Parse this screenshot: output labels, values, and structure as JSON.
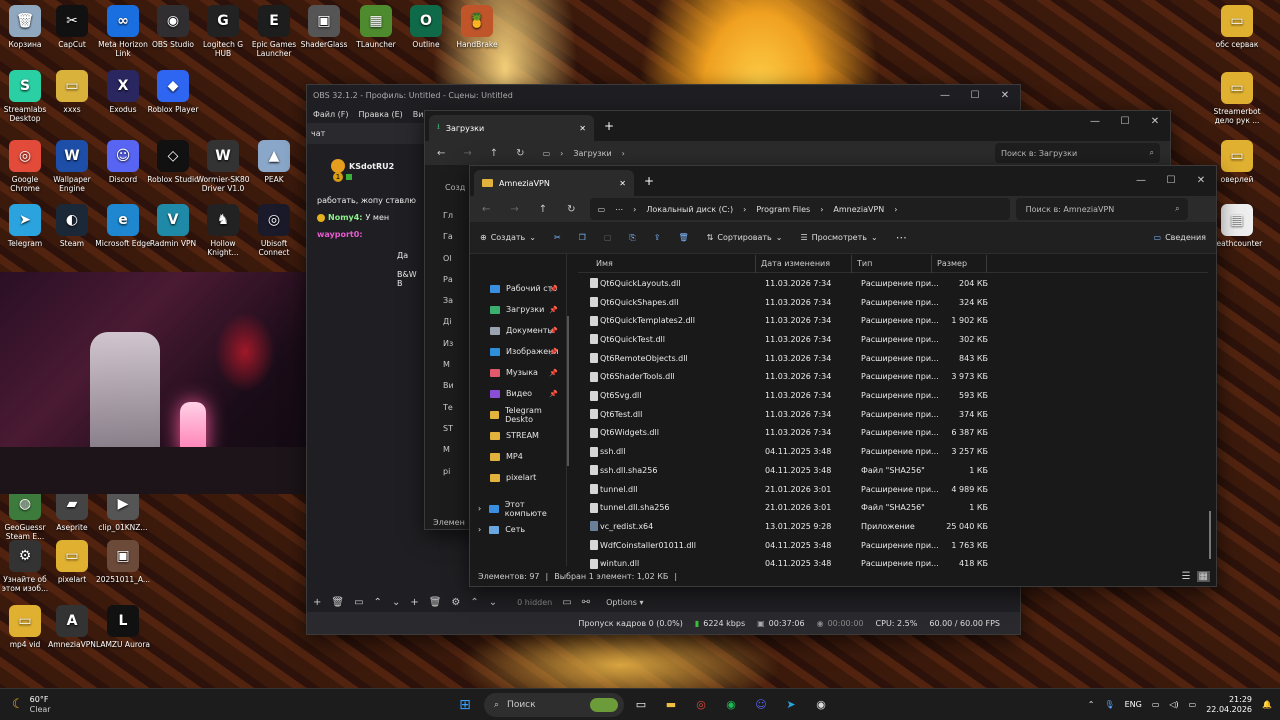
{
  "desktop_icons": [
    {
      "label": "Корзина",
      "color": "#8fa8c0",
      "glyph": "🗑"
    },
    {
      "label": "CapCut",
      "color": "#111",
      "glyph": "✂"
    },
    {
      "label": "Meta Horizon Link",
      "color": "#1a6fe0",
      "glyph": "∞"
    },
    {
      "label": "OBS Studio",
      "color": "#302e31",
      "glyph": "◉"
    },
    {
      "label": "Logitech G HUB",
      "color": "#222",
      "glyph": "G"
    },
    {
      "label": "Epic Games Launcher",
      "color": "#1d1d1d",
      "glyph": "E"
    },
    {
      "label": "ShaderGlass",
      "color": "#555",
      "glyph": "▣"
    },
    {
      "label": "TLauncher",
      "color": "#4e8a2e",
      "glyph": "▦"
    },
    {
      "label": "Outline",
      "color": "#0f6a4a",
      "glyph": "O"
    },
    {
      "label": "HandBrake",
      "color": "#c0552a",
      "glyph": "🍍"
    },
    {
      "label": "Streamlabs Desktop",
      "color": "#2ad0a4",
      "glyph": "S"
    },
    {
      "label": "xxxs",
      "color": "#d9b23b",
      "glyph": "▭"
    },
    {
      "label": "Exodus",
      "color": "#2a2660",
      "glyph": "X"
    },
    {
      "label": "Roblox Player",
      "color": "#2e66f2",
      "glyph": "◆"
    },
    {
      "label": "Google Chrome",
      "color": "#e24a3a",
      "glyph": "◎"
    },
    {
      "label": "Wallpaper Engine",
      "color": "#1d4fa8",
      "glyph": "W"
    },
    {
      "label": "Discord",
      "color": "#5865f2",
      "glyph": "☺"
    },
    {
      "label": "Roblox Studio",
      "color": "#111",
      "glyph": "◇"
    },
    {
      "label": "Wormier-SK80 Driver V1.0",
      "color": "#333",
      "glyph": "W"
    },
    {
      "label": "PEAK",
      "color": "#8aa6c8",
      "glyph": "▲"
    },
    {
      "label": "Telegram",
      "color": "#2aa3df",
      "glyph": "➤"
    },
    {
      "label": "Steam",
      "color": "#1b2838",
      "glyph": "◐"
    },
    {
      "label": "Microsoft Edge",
      "color": "#1f87d0",
      "glyph": "e"
    },
    {
      "label": "Radmin VPN",
      "color": "#1f8aa8",
      "glyph": "V"
    },
    {
      "label": "Hollow Knight...",
      "color": "#222",
      "glyph": "♞"
    },
    {
      "label": "Ubisoft Connect",
      "color": "#1a1a2a",
      "glyph": "◎"
    },
    {
      "label": "GeoGuessr Steam E...",
      "color": "#3d7b3d",
      "glyph": "◍"
    },
    {
      "label": "Aseprite",
      "color": "#444",
      "glyph": "▰"
    },
    {
      "label": "clip_01KNZ...",
      "color": "#555",
      "glyph": "▶"
    },
    {
      "label": "Узнайте об этом изоб...",
      "color": "#333",
      "glyph": "⚙"
    },
    {
      "label": "pixelart",
      "color": "#e0b030",
      "glyph": "▭"
    },
    {
      "label": "20251011_A...",
      "color": "#6b4a3a",
      "glyph": "▣"
    },
    {
      "label": "mp4 vid",
      "color": "#e0b030",
      "glyph": "▭"
    },
    {
      "label": "AmneziaVPN",
      "color": "#333",
      "glyph": "A"
    },
    {
      "label": "LAMZU Aurora",
      "color": "#111",
      "glyph": "L"
    },
    {
      "label": "обс сервак",
      "color": "#e0b030",
      "glyph": "▭"
    },
    {
      "label": "Streamerbot дело рук ...",
      "color": "#e0b030",
      "glyph": "▭"
    },
    {
      "label": "оверлей",
      "color": "#e0b030",
      "glyph": "▭"
    },
    {
      "label": "deathcounter",
      "color": "#eee",
      "glyph": "▤"
    }
  ],
  "obs": {
    "title": "OBS 32.1.2 - Профиль: Untitled - Сцены: Untitled",
    "menu": [
      "Файл (F)",
      "Правка (E)",
      "Вид"
    ],
    "chat_header": "чат",
    "chat": {
      "user1": "KSdotRU2",
      "badge_count": "1",
      "msg1": "работать, жопу ставлю",
      "user2": "Nomy4:",
      "msg2": "У мен",
      "user3": "wayport0:",
      "msg3": "Да",
      "msg4": "B&W B"
    },
    "bottom_hidden": "0 hidden",
    "options": "Options",
    "status": {
      "dropped": "Пропуск кадров 0 (0.0%)",
      "bitrate": "6224 kbps",
      "rec_time": "00:37:06",
      "stream_time": "00:00:00",
      "cpu": "CPU: 2.5%",
      "fps": "60.00 / 60.00 FPS"
    }
  },
  "downloads": {
    "tab": "Загрузки",
    "path": "Загрузки",
    "search": "Поиск в: Загрузки",
    "sidebar_partial": [
      "Гл",
      "Га",
      "Ol",
      "Ра",
      "За",
      "Ді",
      "Из",
      "М",
      "Ви",
      "Те",
      "ST",
      "М",
      "pi"
    ],
    "left_partial_menu": "Созд",
    "element_label": "Элемен"
  },
  "explorer": {
    "tab": "AmneziaVPN",
    "breadcrumb": [
      "Локальный диск (C:)",
      "Program Files",
      "AmneziaVPN"
    ],
    "search_placeholder": "Поиск в: AmneziaVPN",
    "toolbar": {
      "create": "Создать",
      "sort": "Сортировать",
      "view": "Просмотреть",
      "details": "Сведения"
    },
    "columns": {
      "name": "Имя",
      "date": "Дата изменения",
      "type": "Тип",
      "size": "Размер"
    },
    "nav": [
      {
        "label": "Рабочий сто",
        "pin": true,
        "color": "#3a8ee0"
      },
      {
        "label": "Загрузки",
        "pin": true,
        "color": "#3ab06e"
      },
      {
        "label": "Документы",
        "pin": true,
        "color": "#9aa4b0"
      },
      {
        "label": "Изображени",
        "pin": true,
        "color": "#2f8fd8"
      },
      {
        "label": "Музыка",
        "pin": true,
        "color": "#e2596c"
      },
      {
        "label": "Видео",
        "pin": true,
        "color": "#8a4ed8"
      },
      {
        "label": "Telegram Deskto",
        "pin": false,
        "color": "#e2b33c"
      },
      {
        "label": "STREAM",
        "pin": false,
        "color": "#e2b33c"
      },
      {
        "label": "MP4",
        "pin": false,
        "color": "#e2b33c"
      },
      {
        "label": "pixelart",
        "pin": false,
        "color": "#e2b33c"
      }
    ],
    "nav_bottom": [
      "Этот компьюте",
      "Сеть"
    ],
    "files": [
      {
        "name": "Qt6QuickLayouts.dll",
        "date": "11.03.2026 7:34",
        "type": "Расширение при...",
        "size": "204 КБ"
      },
      {
        "name": "Qt6QuickShapes.dll",
        "date": "11.03.2026 7:34",
        "type": "Расширение при...",
        "size": "324 КБ"
      },
      {
        "name": "Qt6QuickTemplates2.dll",
        "date": "11.03.2026 7:34",
        "type": "Расширение при...",
        "size": "1 902 КБ"
      },
      {
        "name": "Qt6QuickTest.dll",
        "date": "11.03.2026 7:34",
        "type": "Расширение при...",
        "size": "302 КБ"
      },
      {
        "name": "Qt6RemoteObjects.dll",
        "date": "11.03.2026 7:34",
        "type": "Расширение при...",
        "size": "843 КБ"
      },
      {
        "name": "Qt6ShaderTools.dll",
        "date": "11.03.2026 7:34",
        "type": "Расширение при...",
        "size": "3 973 КБ"
      },
      {
        "name": "Qt6Svg.dll",
        "date": "11.03.2026 7:34",
        "type": "Расширение при...",
        "size": "593 КБ"
      },
      {
        "name": "Qt6Test.dll",
        "date": "11.03.2026 7:34",
        "type": "Расширение при...",
        "size": "374 КБ"
      },
      {
        "name": "Qt6Widgets.dll",
        "date": "11.03.2026 7:34",
        "type": "Расширение при...",
        "size": "6 387 КБ"
      },
      {
        "name": "ssh.dll",
        "date": "04.11.2025 3:48",
        "type": "Расширение при...",
        "size": "3 257 КБ"
      },
      {
        "name": "ssh.dll.sha256",
        "date": "04.11.2025 3:48",
        "type": "Файл \"SHA256\"",
        "size": "1 КБ"
      },
      {
        "name": "tunnel.dll",
        "date": "21.01.2026 3:01",
        "type": "Расширение при...",
        "size": "4 989 КБ"
      },
      {
        "name": "tunnel.dll.sha256",
        "date": "21.01.2026 3:01",
        "type": "Файл \"SHA256\"",
        "size": "1 КБ"
      },
      {
        "name": "vc_redist.x64",
        "date": "13.01.2025 9:28",
        "type": "Приложение",
        "size": "25 040 КБ"
      },
      {
        "name": "WdfCoinstaller01011.dll",
        "date": "04.11.2025 3:48",
        "type": "Расширение при...",
        "size": "1 763 КБ"
      },
      {
        "name": "wintun.dll",
        "date": "04.11.2025 3:48",
        "type": "Расширение при...",
        "size": "418 КБ"
      }
    ],
    "status": {
      "count": "Элементов: 97",
      "selected": "Выбран 1 элемент: 1,02 КБ"
    }
  },
  "taskbar": {
    "weather_temp": "60°F",
    "weather_desc": "Clear",
    "search": "Поиск",
    "lang": "ENG",
    "time": "21:29",
    "date": "22.04.2026"
  }
}
